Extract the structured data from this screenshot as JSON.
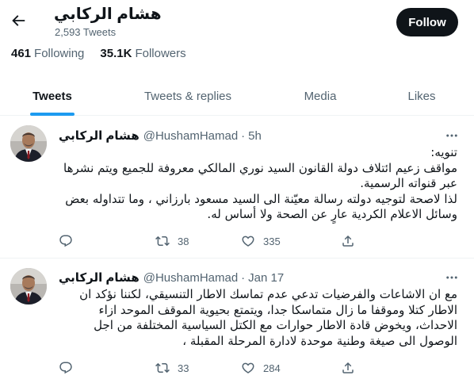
{
  "profile": {
    "name": "هشام الركابي",
    "tweet_count": "2,593 Tweets",
    "follow_label": "Follow",
    "following_count": "461",
    "following_label": "Following",
    "followers_count": "35.1K",
    "followers_label": "Followers"
  },
  "tabs": [
    {
      "label": "Tweets",
      "active": true
    },
    {
      "label": "Tweets & replies",
      "active": false
    },
    {
      "label": "Media",
      "active": false
    },
    {
      "label": "Likes",
      "active": false
    }
  ],
  "tweets": [
    {
      "author": "هشام الركابي",
      "handle": "@HushamHamad",
      "time": "5h",
      "paragraphs": [
        "تنويه:",
        "مواقف زعيم ائتلاف دولة القانون السيد نوري المالكي معروفة للجميع ويتم نشرها عبر قنواته الرسمية.",
        "لذا لاصحة لتوجيه دولته رسالة معيّنة الى السيد مسعود بارزاني ، وما تتداوله بعض وسائل الاعلام الكردية عارٍ عن الصحة ولا أساس له."
      ],
      "retweets": "38",
      "likes": "335"
    },
    {
      "author": "هشام الركابي",
      "handle": "@HushamHamad",
      "time": "Jan 17",
      "paragraphs": [
        "مع ان الاشاعات والفرضيات تدعي عدم تماسك الاطار التنسيقي، لكننا نؤكد ان الاطار كتلا وموقفا ما زال متماسكا جدا، ويتمتع بحيوية الموقف الموحد ازاء الاحداث، ويخوض قادة الاطار حوارات مع الكتل السياسية المختلفة من اجل الوصول الى صيغة وطنية موحدة لادارة المرحلة المقبلة ،"
      ],
      "retweets": "33",
      "likes": "284"
    }
  ],
  "colors": {
    "accent": "#1d9bf0",
    "text_primary": "#0f1419",
    "text_secondary": "#536471",
    "divider": "#eff3f4",
    "follow_bg": "#0f1419"
  },
  "icons": [
    "back-arrow-icon",
    "more-icon",
    "reply-icon",
    "retweet-icon",
    "like-icon",
    "share-icon"
  ]
}
